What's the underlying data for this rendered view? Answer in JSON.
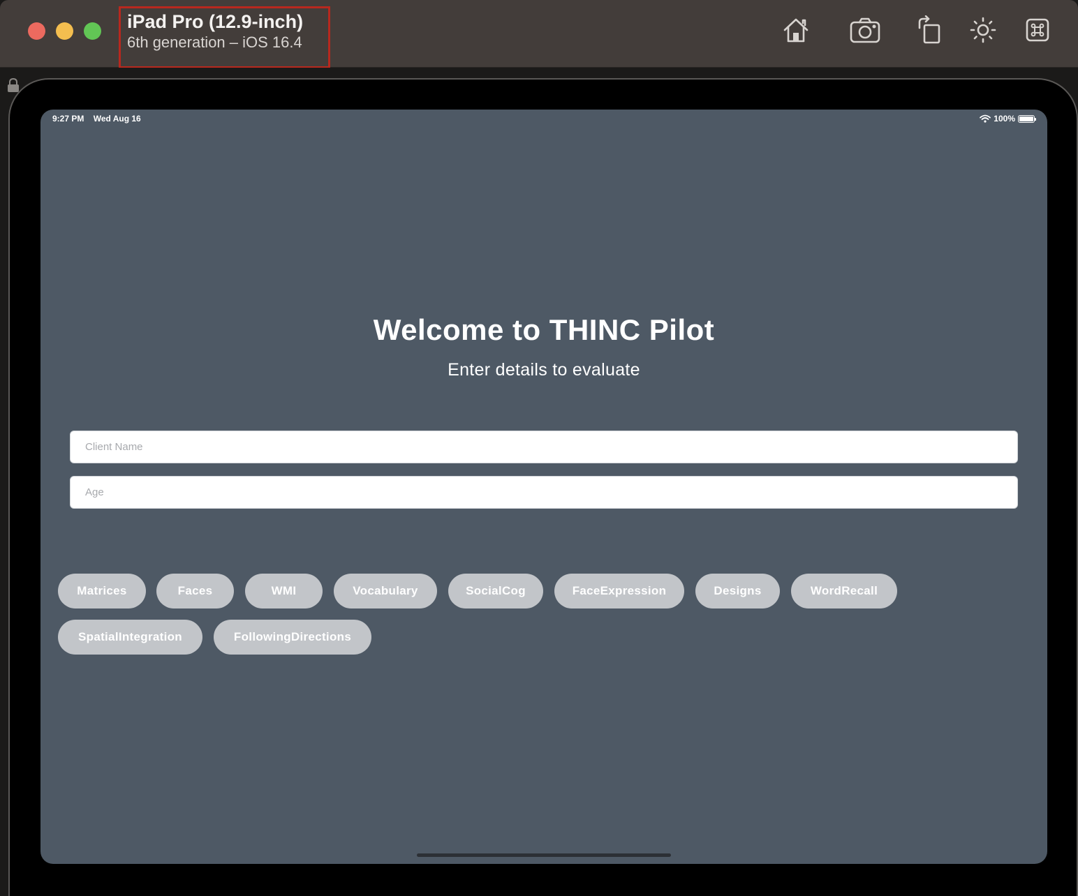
{
  "window": {
    "device_name": "iPad Pro (12.9-inch)",
    "device_subtitle": "6th generation – iOS 16.4",
    "toolbar": [
      {
        "name": "home-icon"
      },
      {
        "name": "screenshot-icon"
      },
      {
        "name": "rotate-icon"
      },
      {
        "name": "brightness-icon"
      },
      {
        "name": "command-icon"
      }
    ]
  },
  "status_bar": {
    "time": "9:27 PM",
    "date": "Wed Aug 16",
    "battery": "100%"
  },
  "main": {
    "title": "Welcome to THINC Pilot",
    "subtitle": "Enter details to evaluate",
    "client_name_placeholder": "Client Name",
    "age_placeholder": "Age",
    "tests": [
      "Matrices",
      "Faces",
      "WMI",
      "Vocabulary",
      "SocialCog",
      "FaceExpression",
      "Designs",
      "WordRecall",
      "SpatialIntegration",
      "FollowingDirections"
    ]
  },
  "colors": {
    "screen_bg": "#4e5965",
    "chip_bg": "#c2c5c9",
    "titlebar_bg": "#433d3a",
    "highlight_border": "#b8281e"
  }
}
